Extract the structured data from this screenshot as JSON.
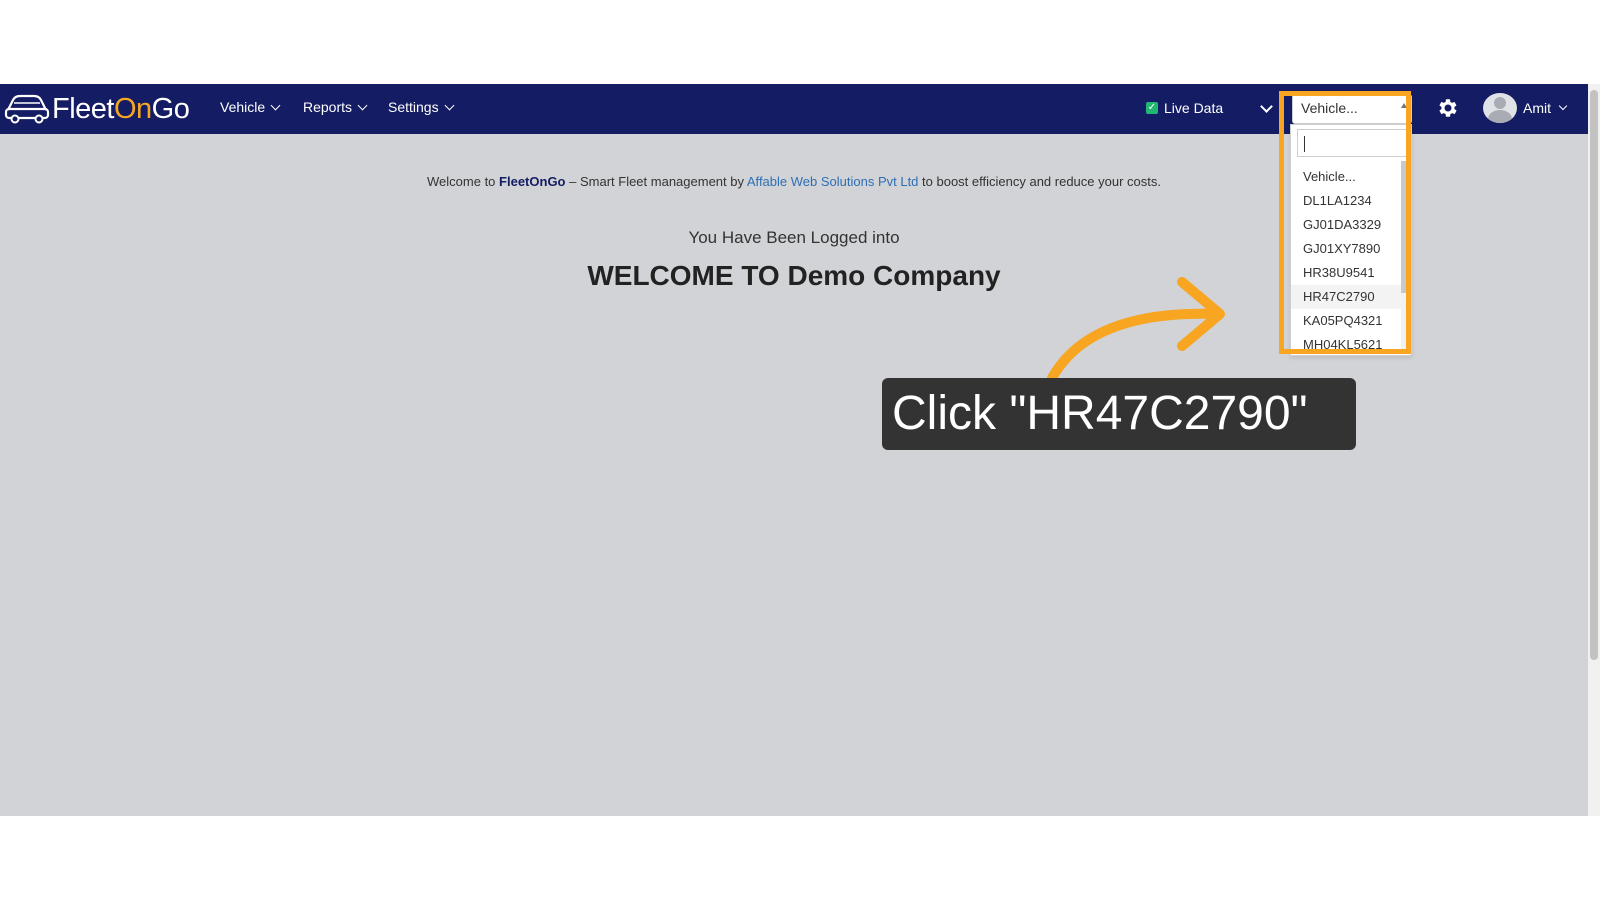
{
  "app": {
    "logo": {
      "part1": "Fleet",
      "part2": "On",
      "part3": "Go",
      "icon": "car-icon"
    },
    "nav": [
      {
        "label": "Vehicle"
      },
      {
        "label": "Reports"
      },
      {
        "label": "Settings"
      }
    ],
    "live_data": {
      "label": "Live Data",
      "checked": true
    },
    "vehicle_select": {
      "selected": "Vehicle...",
      "search_value": ""
    },
    "user": {
      "name": "Amit"
    }
  },
  "main": {
    "welcome_prefix": "Welcome to",
    "brand": "FleetOnGo",
    "welcome_mid": "– Smart Fleet management by",
    "company_link": "Affable Web Solutions Pvt Ltd",
    "welcome_suffix": "to boost efficiency and reduce your costs.",
    "logged_into": "You Have Been Logged into",
    "company_title": "WELCOME TO Demo Company"
  },
  "dropdown": {
    "options": [
      {
        "label": "Vehicle..."
      },
      {
        "label": "DL1LA1234"
      },
      {
        "label": "GJ01DA3329"
      },
      {
        "label": "GJ01XY7890"
      },
      {
        "label": "HR38U9541"
      },
      {
        "label": "HR47C2790"
      },
      {
        "label": "KA05PQ4321"
      },
      {
        "label": "MH04KL5621"
      }
    ]
  },
  "tutorial": {
    "callout_text": "Click \"HR47C2790\"",
    "accent": "#f8a521"
  },
  "colors": {
    "navbar": "#141c63",
    "page_bg": "#d1d3d6",
    "brand_accent": "#f5a623"
  }
}
